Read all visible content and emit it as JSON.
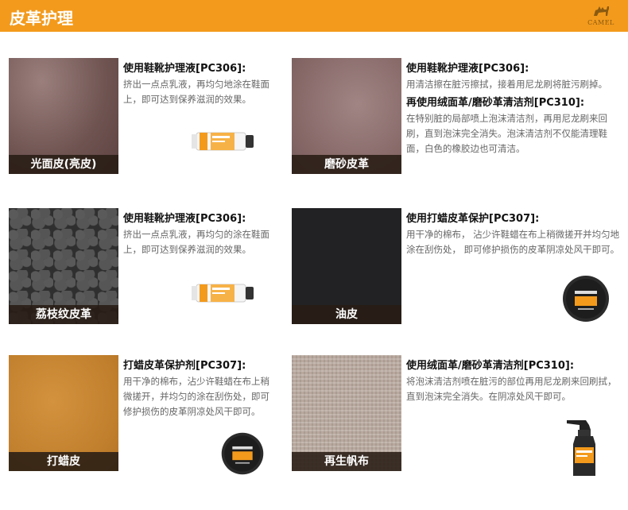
{
  "header": {
    "title": "皮革护理",
    "logo_text": "CAMEL",
    "background_color": "#f39a1c"
  },
  "cards": [
    {
      "label": "光面皮(亮皮)",
      "texture": "glossy-leather",
      "heading1": "使用鞋靴护理液[PC306]:",
      "text1": "挤出一点点乳液，再均匀地涂在鞋面上，即可达到保养滋润的效果。",
      "product": "cream-tube"
    },
    {
      "label": "磨砂皮革",
      "texture": "suede",
      "heading1": "使用鞋靴护理液[PC306]:",
      "text1": "用清洁擦在脏污擦拭，接着用尼龙刷将脏污刷掉。",
      "heading2": "再使用绒面革/磨砂革清洁剂[PC310]:",
      "text2": "在特别脏的局部喷上泡沫清洁剂，再用尼龙刷来回刷，直到泡沫完全消失。泡沫清洁剂不仅能清理鞋面，白色的橡胶边也可清洁。"
    },
    {
      "label": "荔枝纹皮革",
      "texture": "lychee-leather",
      "heading1": "使用鞋靴护理液[PC306]:",
      "text1": "挤出一点点乳液，再均匀的涂在鞋面上，即可达到保养滋润的效果。",
      "product": "cream-tube"
    },
    {
      "label": "油皮",
      "texture": "oil-leather",
      "heading1": "使用打蜡皮革保护[PC307]:",
      "text1": "用干净的棉布， 沾少许鞋蜡在布上稍微搓开并均匀地涂在刮伤处， 即可修护损伤的皮革阴凉处风干即可。",
      "product": "wax-tin"
    },
    {
      "label": "打蜡皮",
      "texture": "waxed-leather",
      "heading1": "打蜡皮革保护剂[PC307]:",
      "text1": "用干净的棉布，沾少许鞋蜡在布上稍微搓开，并均匀的涂在刮伤处，即可修护损伤的皮革阴凉处风干即可。",
      "product": "wax-tin"
    },
    {
      "label": "再生帆布",
      "texture": "canvas",
      "heading1": "使用绒面革/磨砂革清洁剂[PC310]:",
      "text1": "将泡沫清洁剂喷在脏污的部位再用尼龙刷来回刷拭，直到泡沫完全消失。在阴凉处风干即可。",
      "product": "spray-bottle"
    }
  ]
}
